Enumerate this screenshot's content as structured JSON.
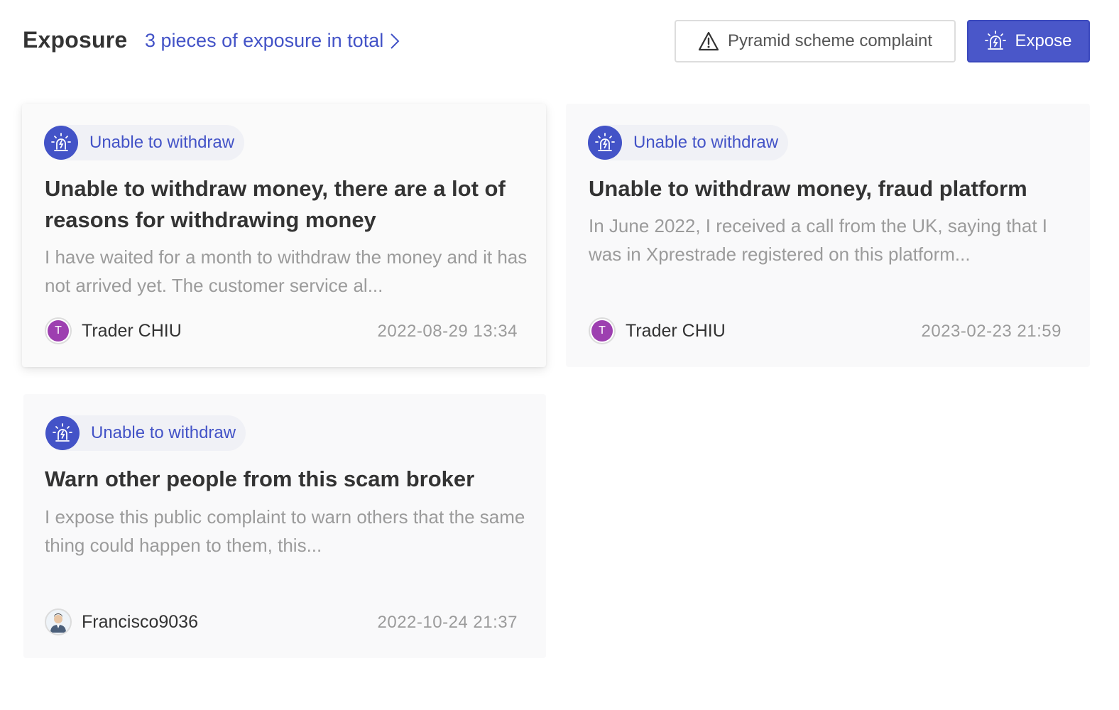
{
  "header": {
    "title": "Exposure",
    "total_link": "3 pieces of exposure in total",
    "complaint_button": "Pyramid scheme complaint",
    "expose_button": "Expose"
  },
  "colors": {
    "accent": "#4353c7",
    "button_primary": "#4a57c9",
    "avatar_purple": "#9d3fb0",
    "muted_text": "#9b9b9b"
  },
  "icons": {
    "tag": "siren-alarm-icon",
    "complaint": "warning-triangle-icon",
    "expose": "siren-alarm-icon",
    "total_link": "chevron-right-icon"
  },
  "cards": [
    {
      "tag": "Unable to withdraw",
      "title": "Unable to withdraw money, there are a lot of reasons for withdrawing money",
      "description": "I have waited for a month to withdraw the money and it has not arrived yet. The customer service al...",
      "author": "Trader CHIU",
      "avatar_letter": "T",
      "date": "2022-08-29 13:34"
    },
    {
      "tag": "Unable to withdraw",
      "title": "Unable to withdraw money, fraud platform",
      "description": "In June 2022, I received a call from the UK, saying that I was in Xprestrade registered on this platform...",
      "author": "Trader CHIU",
      "avatar_letter": "T",
      "date": "2023-02-23 21:59"
    },
    {
      "tag": "Unable to withdraw",
      "title": "Warn other people from this scam broker",
      "description": "I expose this public complaint to warn others that the same thing could happen to them, this...",
      "author": "Francisco9036",
      "avatar_letter": "",
      "date": "2022-10-24 21:37"
    }
  ]
}
